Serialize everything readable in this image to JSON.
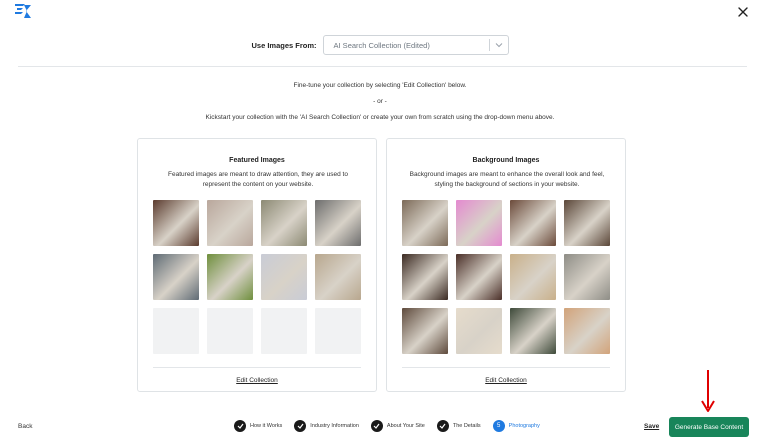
{
  "header": {
    "logo_icon": "lightning-k-logo",
    "close_icon": "close-icon"
  },
  "source": {
    "label": "Use Images From:",
    "selected": "AI Search Collection (Edited)"
  },
  "intro": {
    "line1": "Fine-tune your collection by selecting 'Edit Collection' below.",
    "or": "- or -",
    "line2": "Kickstart your collection with the 'AI Search Collection' or create your own from scratch using the drop-down menu above."
  },
  "featured": {
    "title": "Featured Images",
    "description": "Featured images are meant to draw attention, they are used to represent the content on your website.",
    "edit_label": "Edit Collection",
    "images": [
      {
        "name": "food-spread-photo",
        "bg": "#5b3b2e"
      },
      {
        "name": "hands-phone-photo",
        "bg": "#b9a79c"
      },
      {
        "name": "cafe-table-photo",
        "bg": "#8c8a74"
      },
      {
        "name": "bw-portrait-photo",
        "bg": "#6d6d6d"
      },
      {
        "name": "kitchen-chef-photo",
        "bg": "#5f6b75"
      },
      {
        "name": "woman-plants-photo",
        "bg": "#6f8f3d"
      },
      {
        "name": "pouring-sauce-photo",
        "bg": "#c9ccd6"
      },
      {
        "name": "pink-flower-photo",
        "bg": "#b8a78e"
      },
      {
        "name": "empty-slot"
      },
      {
        "name": "empty-slot"
      },
      {
        "name": "empty-slot"
      },
      {
        "name": "empty-slot"
      }
    ]
  },
  "background": {
    "title": "Background Images",
    "description": "Background images are meant to enhance the overall look and feel, styling the background of sections in your website.",
    "edit_label": "Edit Collection",
    "images": [
      {
        "name": "cooking-woman-photo",
        "bg": "#7c6a58"
      },
      {
        "name": "pink-fork-photo",
        "bg": "#e48ad0"
      },
      {
        "name": "dish-overhead-photo",
        "bg": "#6b4a3a"
      },
      {
        "name": "man-eating-photo",
        "bg": "#5a4638"
      },
      {
        "name": "steak-plate-photo",
        "bg": "#3b2a22"
      },
      {
        "name": "meat-dish-photo",
        "bg": "#4a2f28"
      },
      {
        "name": "pastries-photo",
        "bg": "#c9b08a"
      },
      {
        "name": "women-dining-photo",
        "bg": "#8e8d86"
      },
      {
        "name": "pancakes-photo",
        "bg": "#5e4a3c"
      },
      {
        "name": "pasta-fork-photo",
        "bg": "#e6dccc"
      },
      {
        "name": "phone-photo-food",
        "bg": "#3e4a3a"
      },
      {
        "name": "bruschetta-photo",
        "bg": "#d2a37a"
      }
    ]
  },
  "footer": {
    "back_label": "Back",
    "steps": [
      {
        "label": "How it Works",
        "state": "done"
      },
      {
        "label": "Industry Information",
        "state": "done"
      },
      {
        "label": "About Your Site",
        "state": "done"
      },
      {
        "label": "The Details",
        "state": "done"
      },
      {
        "label": "Photography",
        "state": "active",
        "number": "5"
      }
    ],
    "save_label": "Save",
    "generate_label": "Generate Base Content"
  },
  "colors": {
    "accent_blue": "#1f7ae0",
    "primary_green": "#18855a",
    "annotation_red": "#e00000"
  }
}
